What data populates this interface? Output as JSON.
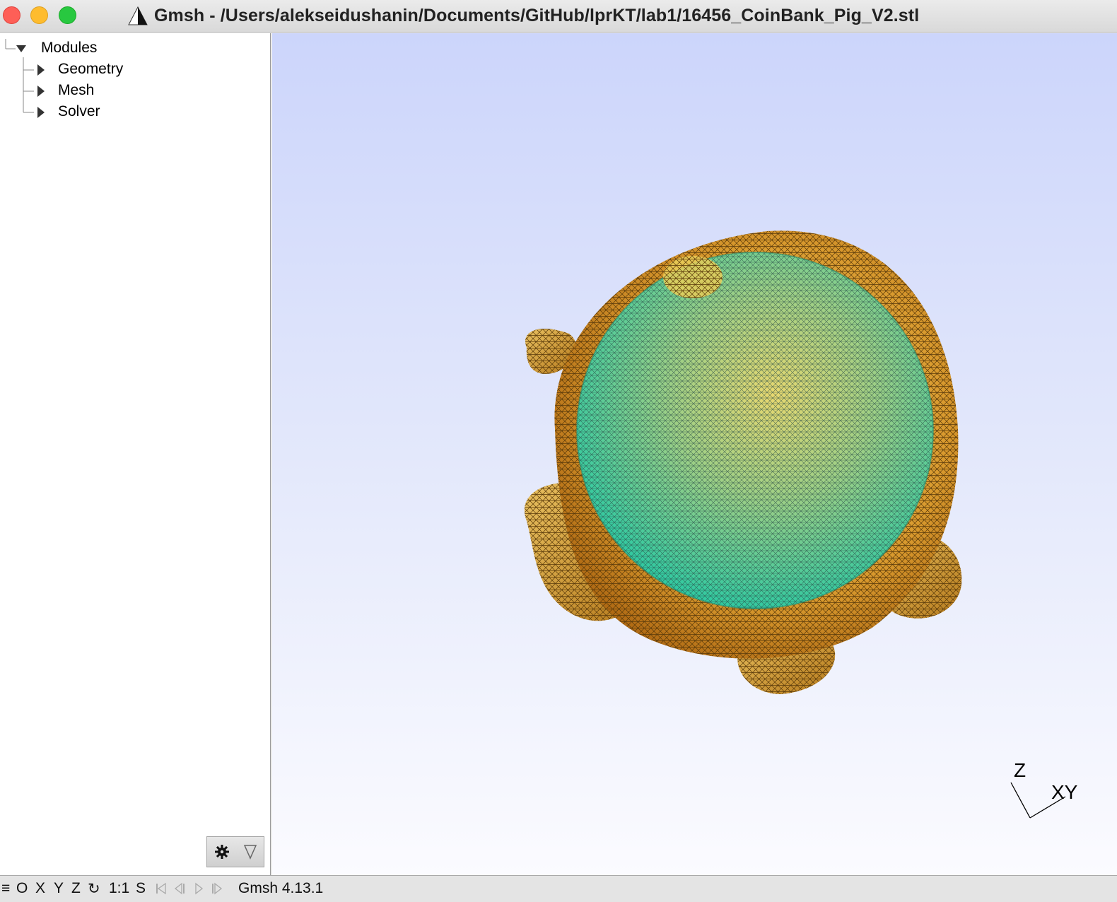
{
  "window": {
    "title": "Gmsh - /Users/alekseidushanin/Documents/GitHub/lprKT/lab1/16456_CoinBank_Pig_V2.stl"
  },
  "tree": {
    "root": "Modules",
    "items": [
      {
        "label": "Geometry"
      },
      {
        "label": "Mesh"
      },
      {
        "label": "Solver"
      }
    ]
  },
  "viewport": {
    "axes": {
      "z": "Z",
      "xy": "XY"
    },
    "model": "wireframe-mesh",
    "colors": {
      "top": "#ccd5fb",
      "bottom": "#fbfbff",
      "mesh_outer": "#c08420",
      "mesh_inner": "#24c4a0"
    }
  },
  "statusbar": {
    "menu_icon": "≡",
    "buttons": [
      "O",
      "X",
      "Y",
      "Z"
    ],
    "rotate_icon": "↻",
    "scale": "1:1",
    "s": "S",
    "version": "Gmsh 4.13.1"
  },
  "icons": {
    "gear": "gear-icon",
    "filter": "filter-icon",
    "first": "first-frame-icon",
    "prev": "prev-frame-icon",
    "play": "play-icon",
    "last": "last-frame-icon"
  }
}
